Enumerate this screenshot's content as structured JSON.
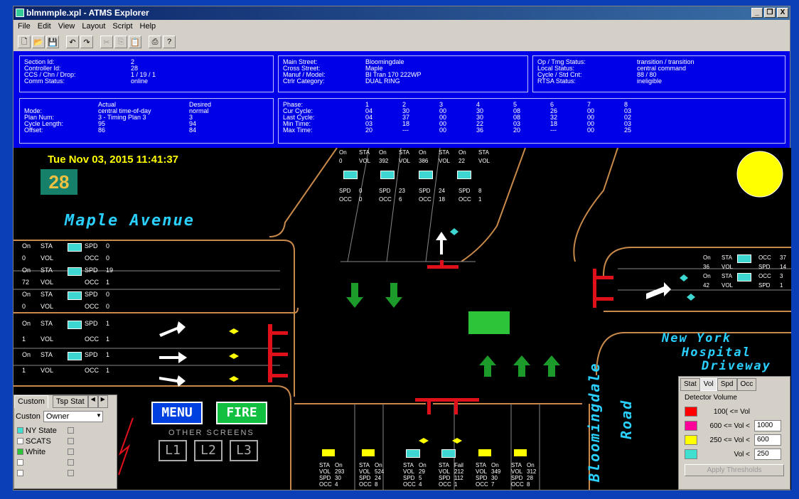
{
  "window": {
    "title": "blmnmple.xpl - ATMS Explorer",
    "min": "_",
    "max": "❐",
    "close": "X"
  },
  "menu": [
    "File",
    "Edit",
    "View",
    "Layout",
    "Script",
    "Help"
  ],
  "info1": {
    "labels": [
      "Section Id:",
      "Controller Id:",
      "CCS / Chn / Drop:",
      "Comm Status:"
    ],
    "values": [
      "2",
      "28",
      "1 / 19 / 1",
      "online"
    ]
  },
  "info2": {
    "labels": [
      "Main Street:",
      "Cross Street:",
      "Manuf / Model:",
      "Ctrlr Category:"
    ],
    "values": [
      "Bloomingdale",
      "Maple",
      "BI Tran 170 222WP",
      "DUAL RING"
    ]
  },
  "info3": {
    "labels": [
      "Op / Tmg Status:",
      "Local Status:",
      "Cycle / Std Cnt:",
      "RTSA Status:"
    ],
    "values": [
      "transition / transition",
      "central command",
      "88 / 80",
      "ineligible"
    ]
  },
  "mode": {
    "h_actual": "Actual",
    "h_desired": "Desired",
    "rows": [
      [
        "Mode:",
        "central time-of-day",
        "normal"
      ],
      [
        "Plan Num:",
        "3 - Timing Plan 3",
        "3"
      ],
      [
        "Cycle Length:",
        "95",
        "94"
      ],
      [
        "Offset:",
        "86",
        "84"
      ]
    ]
  },
  "phase": {
    "header": [
      "Phase:",
      "1",
      "2",
      "3",
      "4",
      "5",
      "6",
      "7",
      "8"
    ],
    "rows": [
      [
        "Cur Cycle:",
        "04",
        "30",
        "00",
        "30",
        "08",
        "26",
        "00",
        "03"
      ],
      [
        "Last Cycle:",
        "04",
        "37",
        "00",
        "30",
        "08",
        "32",
        "00",
        "02"
      ],
      [
        "Min Time:",
        "03",
        "18",
        "00",
        "22",
        "03",
        "18",
        "00",
        "03"
      ],
      [
        "Max Time:",
        "20",
        "---",
        "00",
        "36",
        "20",
        "---",
        "00",
        "25"
      ]
    ]
  },
  "map": {
    "datetime": "Tue Nov 03, 2015 11:41:37",
    "controller": "28",
    "maple": "Maple Avenue",
    "ny": [
      "New York",
      "Hospital",
      "Driveway"
    ],
    "bloom": [
      "Bloomingdale",
      "Road"
    ],
    "left_det": [
      [
        "On",
        "STA",
        "SPD",
        "0"
      ],
      [
        "0",
        "VOL",
        "OCC",
        "0"
      ],
      [
        "On",
        "STA",
        "SPD",
        "19"
      ],
      [
        "72",
        "VOL",
        "OCC",
        "1"
      ],
      [
        "On",
        "STA",
        "SPD",
        "0"
      ],
      [
        "0",
        "VOL",
        "OCC",
        "0"
      ]
    ],
    "left_det2": [
      [
        "On",
        "STA",
        "SPD",
        "1"
      ],
      [
        "1",
        "VOL",
        "OCC",
        "1"
      ],
      [
        "On",
        "STA",
        "SPD",
        "1"
      ],
      [
        "1",
        "VOL",
        "OCC",
        "1"
      ]
    ],
    "top_det": [
      [
        "On",
        "STA",
        "On",
        "STA",
        "On",
        "STA",
        "On",
        "STA"
      ],
      [
        "0",
        "VOL",
        "392",
        "VOL",
        "386",
        "VOL",
        "22",
        "VOL"
      ]
    ],
    "top_spd": [
      [
        "SPD",
        "0",
        "SPD",
        "23",
        "SPD",
        "24",
        "SPD",
        "8"
      ],
      [
        "OCC",
        "0",
        "OCC",
        "6",
        "OCC",
        "18",
        "OCC",
        "1"
      ]
    ],
    "right_det": [
      [
        "On",
        "STA",
        "OCC",
        "37"
      ],
      [
        "36",
        "VOL",
        "SPD",
        "14"
      ],
      [
        "On",
        "STA",
        "OCC",
        "3"
      ],
      [
        "42",
        "VOL",
        "SPD",
        "1"
      ]
    ],
    "bottom_det": [
      [
        "STA",
        "On",
        "STA",
        "On",
        "STA",
        "On",
        "STA",
        "Fail",
        "STA",
        "On",
        "STA",
        "On"
      ],
      [
        "VOL",
        "293",
        "VOL",
        "524",
        "VOL",
        "29",
        "VOL",
        "212",
        "VOL",
        "349",
        "VOL",
        "312"
      ],
      [
        "SPD",
        "30",
        "SPD",
        "24",
        "SPD",
        "5",
        "SPD",
        "112",
        "SPD",
        "30",
        "SPD",
        "28"
      ],
      [
        "OCC",
        "4",
        "OCC",
        "8",
        "OCC",
        "4",
        "OCC",
        "1",
        "OCC",
        "7",
        "OCC",
        "8"
      ]
    ],
    "menu_btn": "MENU",
    "fire_btn": "FIRE",
    "other": "OTHER SCREENS",
    "l1": "L1",
    "l2": "L2",
    "l3": "L3"
  },
  "side": {
    "tab1": "Custom",
    "tab2": "Tsp Stat",
    "label": "Custon",
    "select": "Owner",
    "items": [
      "NY State",
      "SCATS",
      "White",
      "",
      ""
    ]
  },
  "legend": {
    "tabs": [
      "Stat",
      "Vol",
      "Spd",
      "Occ"
    ],
    "title": "Detector Volume",
    "rows": [
      "100( <= Vol",
      "600  <= Vol <",
      "250  <= Vol <",
      "Vol <"
    ],
    "vals": [
      "",
      "1000",
      "600",
      "250"
    ],
    "colors": [
      "#ff0000",
      "#ff0099",
      "#ffff00",
      "#40e0d0"
    ],
    "apply": "Apply Thresholds"
  }
}
